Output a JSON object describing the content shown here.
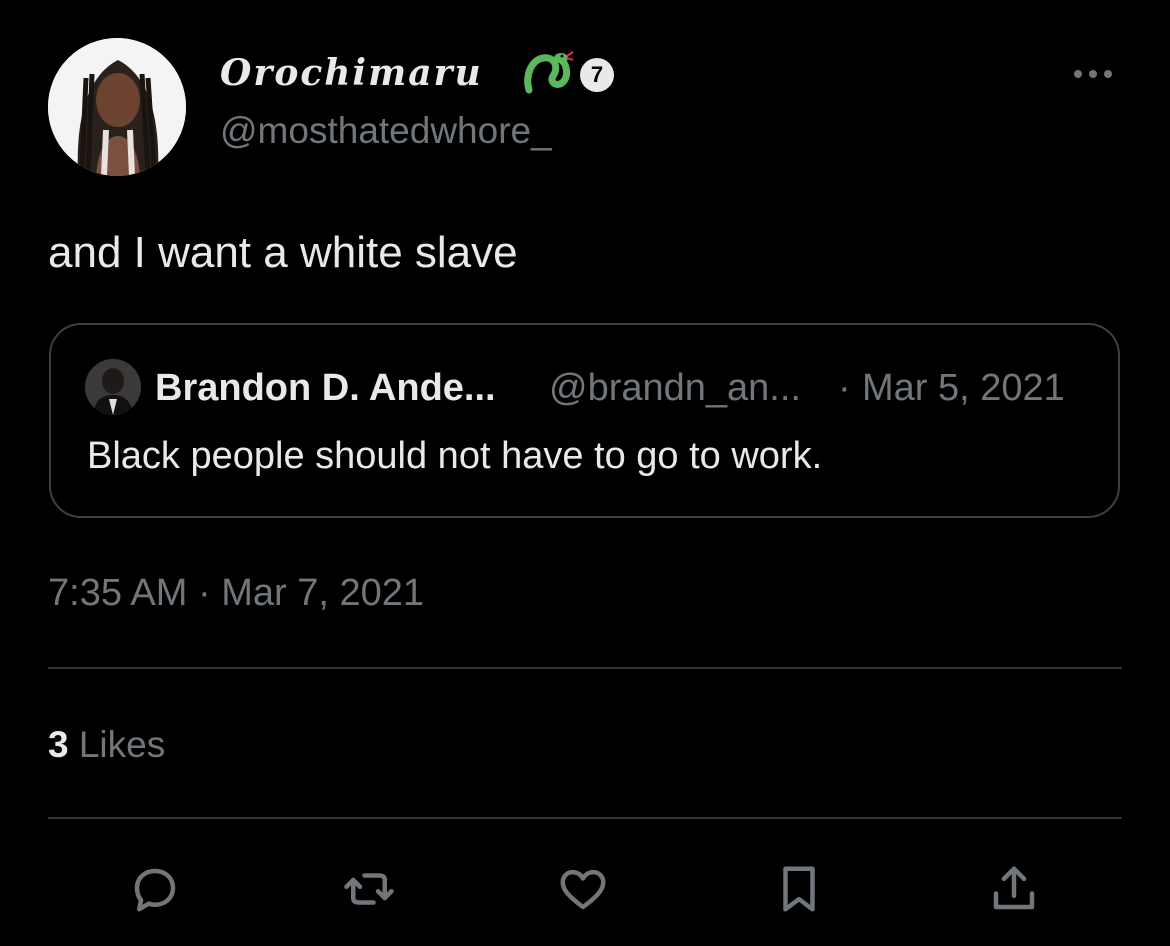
{
  "author": {
    "display_name": "Orochimaru",
    "handle": "@mosthatedwhore_",
    "badge": "7",
    "emoji_icon": "snake-icon"
  },
  "tweet": {
    "text": "and I want a white slave",
    "timestamp": "7:35 AM",
    "separator": "·",
    "date": "Mar 7, 2021"
  },
  "quote": {
    "name": "Brandon D. Ande...",
    "handle": "@brandn_an...",
    "separator": "·",
    "date": "Mar 5, 2021",
    "text": "Black people should not have to go to work."
  },
  "stats": {
    "likes_count": "3",
    "likes_label": "Likes"
  },
  "actions": [
    "reply-icon",
    "retweet-icon",
    "like-icon",
    "bookmark-icon",
    "share-icon"
  ],
  "colors": {
    "background": "#000000",
    "text_primary": "#e7e9ea",
    "text_secondary": "#71767b",
    "divider": "#2f3336",
    "snake": "#5cb85c"
  }
}
